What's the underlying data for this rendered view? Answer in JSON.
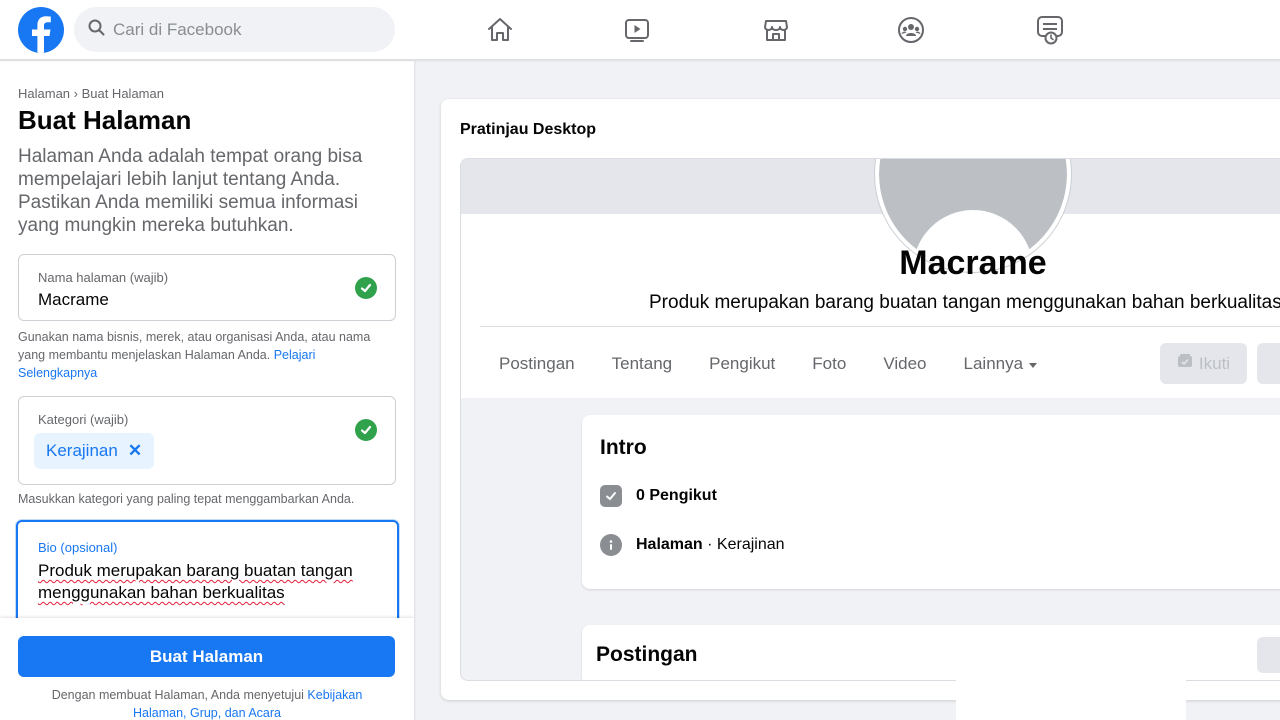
{
  "topbar": {
    "search_placeholder": "Cari di Facebook",
    "logo_letter": "f",
    "nav_icons": [
      "home-icon",
      "watch-icon",
      "marketplace-icon",
      "groups-icon",
      "gaming-icon"
    ]
  },
  "left_panel": {
    "breadcrumb": "Halaman › Buat Halaman",
    "title": "Buat Halaman",
    "description": "Halaman Anda adalah tempat orang bisa mempelajari lebih lanjut tentang Anda. Pastikan Anda memiliki semua informasi yang mungkin mereka butuhkan.",
    "name_field": {
      "label": "Nama halaman (wajib)",
      "value": "Macrame"
    },
    "name_helper": "Gunakan nama bisnis, merek, atau organisasi Anda, atau nama yang membantu menjelaskan Halaman Anda.",
    "name_helper_link": "Pelajari Selengkapnya",
    "category_field": {
      "label": "Kategori (wajib)",
      "chip": "Kerajinan",
      "chip_remove": "✕"
    },
    "category_helper": "Masukkan kategori yang paling tepat menggambarkan Anda.",
    "bio_field": {
      "label": "Bio (opsional)",
      "value": "Produk merupakan barang buatan tangan menggunakan bahan berkualitas"
    },
    "create_button": "Buat Halaman",
    "terms_prefix": "Dengan membuat Halaman, Anda menyetujui",
    "terms_link": "Kebijakan Halaman, Grup, dan Acara"
  },
  "preview": {
    "title": "Pratinjau Desktop",
    "page_name": "Macrame",
    "page_bio": "Produk merupakan barang buatan tangan menggunakan bahan berkualitas",
    "tabs": [
      "Postingan",
      "Tentang",
      "Pengikut",
      "Foto",
      "Video",
      "Lainnya"
    ],
    "follow_button": "Ikuti",
    "intro": {
      "title": "Intro",
      "followers": "0 Pengikut",
      "page_type_bold": "Halaman",
      "page_type_rest": " · Kerajinan"
    },
    "posts_title": "Postingan"
  },
  "colors": {
    "brand": "#1877f2",
    "success": "#31a24c",
    "background": "#f0f2f5"
  }
}
